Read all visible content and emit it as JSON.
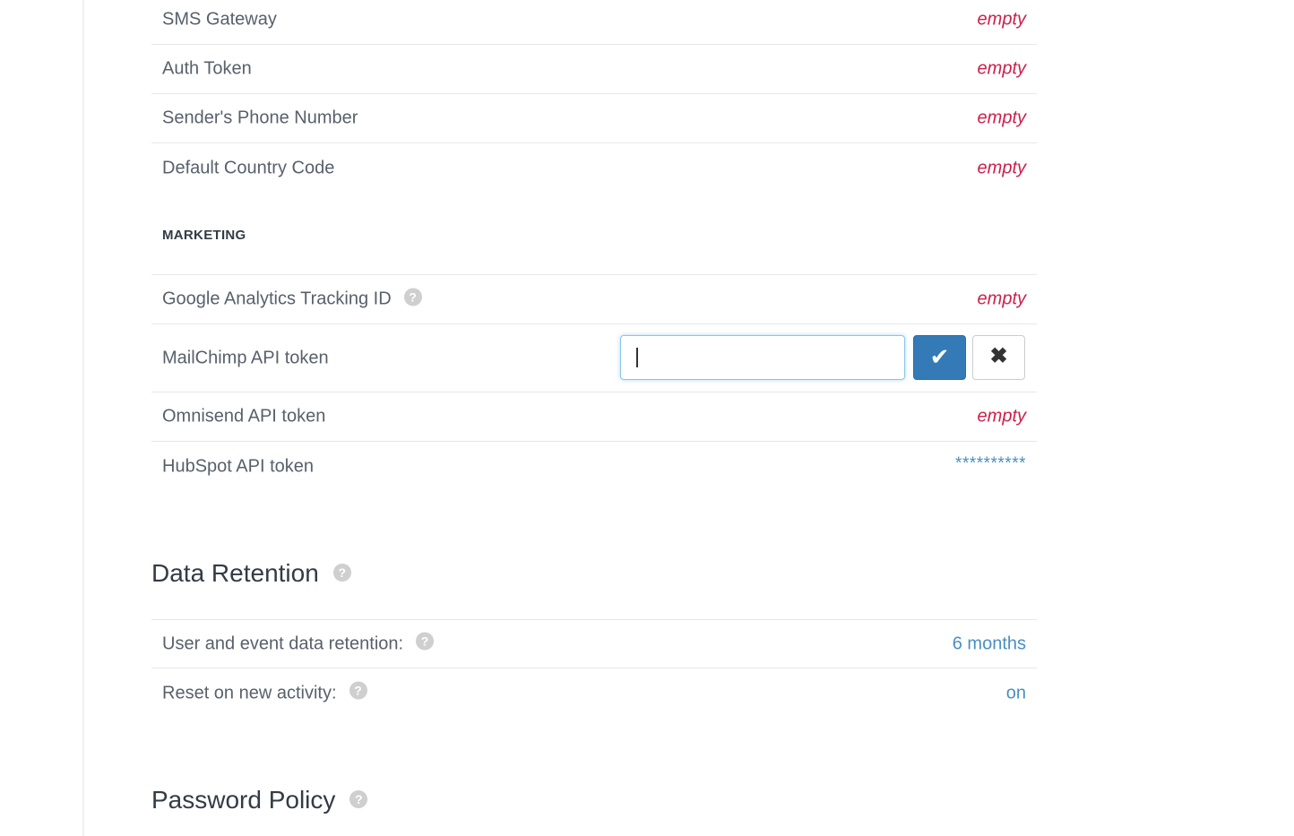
{
  "sms": {
    "rows": [
      {
        "label": "SMS Gateway",
        "value": "empty"
      },
      {
        "label": "Auth Token",
        "value": "empty"
      },
      {
        "label": "Sender's Phone Number",
        "value": "empty"
      },
      {
        "label": "Default Country Code",
        "value": "empty"
      }
    ]
  },
  "marketing": {
    "heading": "MARKETING",
    "google_analytics": {
      "label": "Google Analytics Tracking ID",
      "value": "empty"
    },
    "mailchimp": {
      "label": "MailChimp API token",
      "input_value": "",
      "save_icon": "check-icon",
      "cancel_icon": "close-icon",
      "save_glyph": "✔",
      "cancel_glyph": "✖"
    },
    "omnisend": {
      "label": "Omnisend API token",
      "value": "empty"
    },
    "hubspot": {
      "label": "HubSpot API token",
      "value": "**********"
    }
  },
  "data_retention": {
    "title": "Data Retention",
    "rows": [
      {
        "label": "User and event data retention:",
        "value": "6 months"
      },
      {
        "label": "Reset on new activity:",
        "value": "on"
      }
    ]
  },
  "password_policy": {
    "title": "Password Policy"
  },
  "help_glyph": "?",
  "colors": {
    "empty_value": "#cc1f4a",
    "link_value": "#4a8fc3",
    "primary_button": "#337ab7",
    "help_icon": "#cfcfcf"
  }
}
